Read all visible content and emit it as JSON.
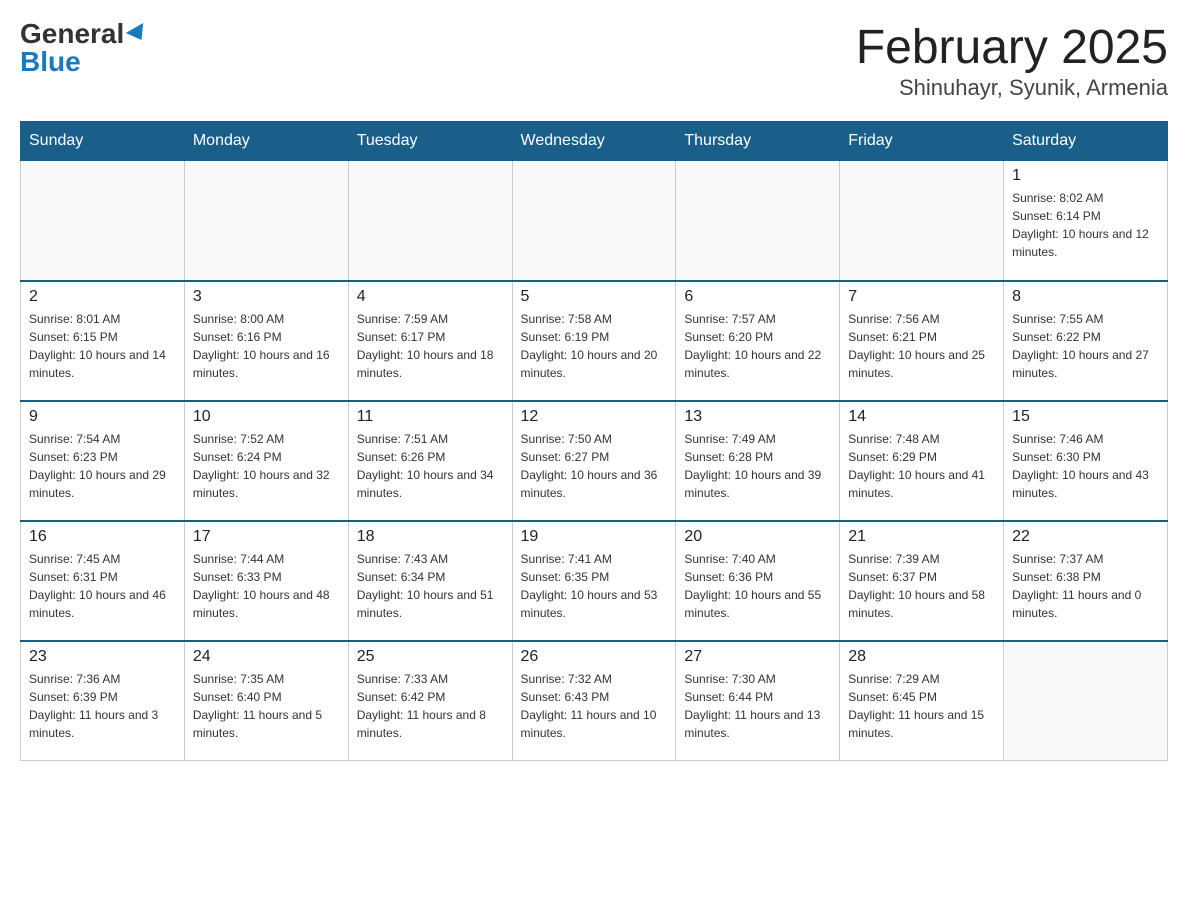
{
  "header": {
    "logo_general": "General",
    "logo_blue": "Blue",
    "title": "February 2025",
    "subtitle": "Shinuhayr, Syunik, Armenia"
  },
  "weekdays": [
    "Sunday",
    "Monday",
    "Tuesday",
    "Wednesday",
    "Thursday",
    "Friday",
    "Saturday"
  ],
  "weeks": [
    [
      {
        "day": "",
        "sunrise": "",
        "sunset": "",
        "daylight": ""
      },
      {
        "day": "",
        "sunrise": "",
        "sunset": "",
        "daylight": ""
      },
      {
        "day": "",
        "sunrise": "",
        "sunset": "",
        "daylight": ""
      },
      {
        "day": "",
        "sunrise": "",
        "sunset": "",
        "daylight": ""
      },
      {
        "day": "",
        "sunrise": "",
        "sunset": "",
        "daylight": ""
      },
      {
        "day": "",
        "sunrise": "",
        "sunset": "",
        "daylight": ""
      },
      {
        "day": "1",
        "sunrise": "Sunrise: 8:02 AM",
        "sunset": "Sunset: 6:14 PM",
        "daylight": "Daylight: 10 hours and 12 minutes."
      }
    ],
    [
      {
        "day": "2",
        "sunrise": "Sunrise: 8:01 AM",
        "sunset": "Sunset: 6:15 PM",
        "daylight": "Daylight: 10 hours and 14 minutes."
      },
      {
        "day": "3",
        "sunrise": "Sunrise: 8:00 AM",
        "sunset": "Sunset: 6:16 PM",
        "daylight": "Daylight: 10 hours and 16 minutes."
      },
      {
        "day": "4",
        "sunrise": "Sunrise: 7:59 AM",
        "sunset": "Sunset: 6:17 PM",
        "daylight": "Daylight: 10 hours and 18 minutes."
      },
      {
        "day": "5",
        "sunrise": "Sunrise: 7:58 AM",
        "sunset": "Sunset: 6:19 PM",
        "daylight": "Daylight: 10 hours and 20 minutes."
      },
      {
        "day": "6",
        "sunrise": "Sunrise: 7:57 AM",
        "sunset": "Sunset: 6:20 PM",
        "daylight": "Daylight: 10 hours and 22 minutes."
      },
      {
        "day": "7",
        "sunrise": "Sunrise: 7:56 AM",
        "sunset": "Sunset: 6:21 PM",
        "daylight": "Daylight: 10 hours and 25 minutes."
      },
      {
        "day": "8",
        "sunrise": "Sunrise: 7:55 AM",
        "sunset": "Sunset: 6:22 PM",
        "daylight": "Daylight: 10 hours and 27 minutes."
      }
    ],
    [
      {
        "day": "9",
        "sunrise": "Sunrise: 7:54 AM",
        "sunset": "Sunset: 6:23 PM",
        "daylight": "Daylight: 10 hours and 29 minutes."
      },
      {
        "day": "10",
        "sunrise": "Sunrise: 7:52 AM",
        "sunset": "Sunset: 6:24 PM",
        "daylight": "Daylight: 10 hours and 32 minutes."
      },
      {
        "day": "11",
        "sunrise": "Sunrise: 7:51 AM",
        "sunset": "Sunset: 6:26 PM",
        "daylight": "Daylight: 10 hours and 34 minutes."
      },
      {
        "day": "12",
        "sunrise": "Sunrise: 7:50 AM",
        "sunset": "Sunset: 6:27 PM",
        "daylight": "Daylight: 10 hours and 36 minutes."
      },
      {
        "day": "13",
        "sunrise": "Sunrise: 7:49 AM",
        "sunset": "Sunset: 6:28 PM",
        "daylight": "Daylight: 10 hours and 39 minutes."
      },
      {
        "day": "14",
        "sunrise": "Sunrise: 7:48 AM",
        "sunset": "Sunset: 6:29 PM",
        "daylight": "Daylight: 10 hours and 41 minutes."
      },
      {
        "day": "15",
        "sunrise": "Sunrise: 7:46 AM",
        "sunset": "Sunset: 6:30 PM",
        "daylight": "Daylight: 10 hours and 43 minutes."
      }
    ],
    [
      {
        "day": "16",
        "sunrise": "Sunrise: 7:45 AM",
        "sunset": "Sunset: 6:31 PM",
        "daylight": "Daylight: 10 hours and 46 minutes."
      },
      {
        "day": "17",
        "sunrise": "Sunrise: 7:44 AM",
        "sunset": "Sunset: 6:33 PM",
        "daylight": "Daylight: 10 hours and 48 minutes."
      },
      {
        "day": "18",
        "sunrise": "Sunrise: 7:43 AM",
        "sunset": "Sunset: 6:34 PM",
        "daylight": "Daylight: 10 hours and 51 minutes."
      },
      {
        "day": "19",
        "sunrise": "Sunrise: 7:41 AM",
        "sunset": "Sunset: 6:35 PM",
        "daylight": "Daylight: 10 hours and 53 minutes."
      },
      {
        "day": "20",
        "sunrise": "Sunrise: 7:40 AM",
        "sunset": "Sunset: 6:36 PM",
        "daylight": "Daylight: 10 hours and 55 minutes."
      },
      {
        "day": "21",
        "sunrise": "Sunrise: 7:39 AM",
        "sunset": "Sunset: 6:37 PM",
        "daylight": "Daylight: 10 hours and 58 minutes."
      },
      {
        "day": "22",
        "sunrise": "Sunrise: 7:37 AM",
        "sunset": "Sunset: 6:38 PM",
        "daylight": "Daylight: 11 hours and 0 minutes."
      }
    ],
    [
      {
        "day": "23",
        "sunrise": "Sunrise: 7:36 AM",
        "sunset": "Sunset: 6:39 PM",
        "daylight": "Daylight: 11 hours and 3 minutes."
      },
      {
        "day": "24",
        "sunrise": "Sunrise: 7:35 AM",
        "sunset": "Sunset: 6:40 PM",
        "daylight": "Daylight: 11 hours and 5 minutes."
      },
      {
        "day": "25",
        "sunrise": "Sunrise: 7:33 AM",
        "sunset": "Sunset: 6:42 PM",
        "daylight": "Daylight: 11 hours and 8 minutes."
      },
      {
        "day": "26",
        "sunrise": "Sunrise: 7:32 AM",
        "sunset": "Sunset: 6:43 PM",
        "daylight": "Daylight: 11 hours and 10 minutes."
      },
      {
        "day": "27",
        "sunrise": "Sunrise: 7:30 AM",
        "sunset": "Sunset: 6:44 PM",
        "daylight": "Daylight: 11 hours and 13 minutes."
      },
      {
        "day": "28",
        "sunrise": "Sunrise: 7:29 AM",
        "sunset": "Sunset: 6:45 PM",
        "daylight": "Daylight: 11 hours and 15 minutes."
      },
      {
        "day": "",
        "sunrise": "",
        "sunset": "",
        "daylight": ""
      }
    ]
  ]
}
